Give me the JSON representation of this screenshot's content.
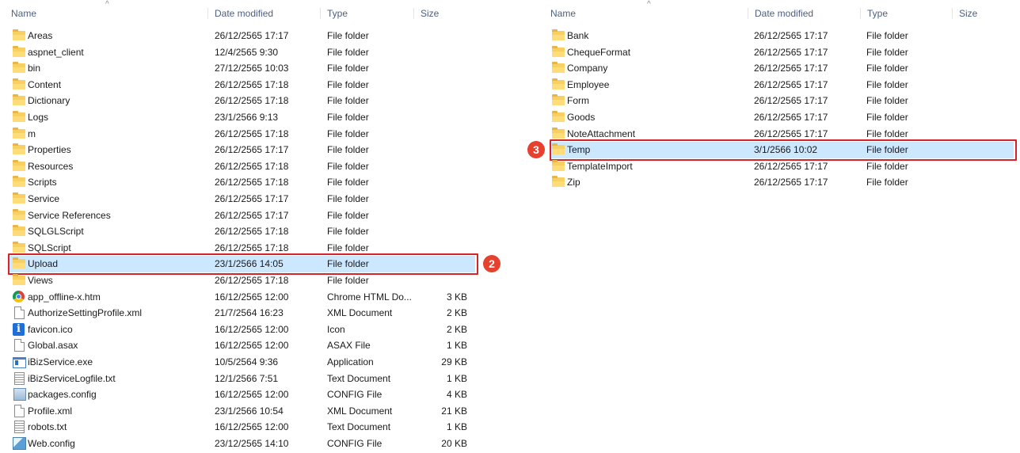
{
  "columns": {
    "name": "Name",
    "date": "Date modified",
    "type": "Type",
    "size": "Size"
  },
  "left_pane": {
    "rows": [
      {
        "name": "Areas",
        "date": "26/12/2565 17:17",
        "type": "File folder",
        "size": "",
        "icon": "folder-icon"
      },
      {
        "name": "aspnet_client",
        "date": "12/4/2565 9:30",
        "type": "File folder",
        "size": "",
        "icon": "folder-icon"
      },
      {
        "name": "bin",
        "date": "27/12/2565 10:03",
        "type": "File folder",
        "size": "",
        "icon": "folder-icon"
      },
      {
        "name": "Content",
        "date": "26/12/2565 17:18",
        "type": "File folder",
        "size": "",
        "icon": "folder-icon"
      },
      {
        "name": "Dictionary",
        "date": "26/12/2565 17:18",
        "type": "File folder",
        "size": "",
        "icon": "folder-icon"
      },
      {
        "name": "Logs",
        "date": "23/1/2566 9:13",
        "type": "File folder",
        "size": "",
        "icon": "folder-icon"
      },
      {
        "name": "m",
        "date": "26/12/2565 17:18",
        "type": "File folder",
        "size": "",
        "icon": "folder-icon"
      },
      {
        "name": "Properties",
        "date": "26/12/2565 17:17",
        "type": "File folder",
        "size": "",
        "icon": "folder-icon"
      },
      {
        "name": "Resources",
        "date": "26/12/2565 17:18",
        "type": "File folder",
        "size": "",
        "icon": "folder-icon"
      },
      {
        "name": "Scripts",
        "date": "26/12/2565 17:18",
        "type": "File folder",
        "size": "",
        "icon": "folder-icon"
      },
      {
        "name": "Service",
        "date": "26/12/2565 17:17",
        "type": "File folder",
        "size": "",
        "icon": "folder-icon"
      },
      {
        "name": "Service References",
        "date": "26/12/2565 17:17",
        "type": "File folder",
        "size": "",
        "icon": "folder-icon"
      },
      {
        "name": "SQLGLScript",
        "date": "26/12/2565 17:18",
        "type": "File folder",
        "size": "",
        "icon": "folder-icon"
      },
      {
        "name": "SQLScript",
        "date": "26/12/2565 17:18",
        "type": "File folder",
        "size": "",
        "icon": "folder-icon"
      },
      {
        "name": "Upload",
        "date": "23/1/2566 14:05",
        "type": "File folder",
        "size": "",
        "icon": "folder-icon",
        "selected": true,
        "callout": "2"
      },
      {
        "name": "Views",
        "date": "26/12/2565 17:18",
        "type": "File folder",
        "size": "",
        "icon": "folder-icon"
      },
      {
        "name": "app_offline-x.htm",
        "date": "16/12/2565 12:00",
        "type": "Chrome HTML Do...",
        "size": "3 KB",
        "icon": "chrome-icon"
      },
      {
        "name": "AuthorizeSettingProfile.xml",
        "date": "21/7/2564 16:23",
        "type": "XML Document",
        "size": "2 KB",
        "icon": "document-icon"
      },
      {
        "name": "favicon.ico",
        "date": "16/12/2565 12:00",
        "type": "Icon",
        "size": "2 KB",
        "icon": "info-icon"
      },
      {
        "name": "Global.asax",
        "date": "16/12/2565 12:00",
        "type": "ASAX File",
        "size": "1 KB",
        "icon": "document-icon"
      },
      {
        "name": "iBizService.exe",
        "date": "10/5/2564 9:36",
        "type": "Application",
        "size": "29 KB",
        "icon": "application-icon"
      },
      {
        "name": "iBizServiceLogfile.txt",
        "date": "12/1/2566 7:51",
        "type": "Text Document",
        "size": "1 KB",
        "icon": "text-file-icon"
      },
      {
        "name": "packages.config",
        "date": "16/12/2565 12:00",
        "type": "CONFIG File",
        "size": "4 KB",
        "icon": "config-icon"
      },
      {
        "name": "Profile.xml",
        "date": "23/1/2566 10:54",
        "type": "XML Document",
        "size": "21 KB",
        "icon": "document-icon"
      },
      {
        "name": "robots.txt",
        "date": "16/12/2565 12:00",
        "type": "Text Document",
        "size": "1 KB",
        "icon": "text-file-icon"
      },
      {
        "name": "Web.config",
        "date": "23/12/2565 14:10",
        "type": "CONFIG File",
        "size": "20 KB",
        "icon": "web-config-icon"
      }
    ]
  },
  "right_pane": {
    "rows": [
      {
        "name": "Bank",
        "date": "26/12/2565 17:17",
        "type": "File folder",
        "size": "",
        "icon": "folder-icon"
      },
      {
        "name": "ChequeFormat",
        "date": "26/12/2565 17:17",
        "type": "File folder",
        "size": "",
        "icon": "folder-icon"
      },
      {
        "name": "Company",
        "date": "26/12/2565 17:17",
        "type": "File folder",
        "size": "",
        "icon": "folder-icon"
      },
      {
        "name": "Employee",
        "date": "26/12/2565 17:17",
        "type": "File folder",
        "size": "",
        "icon": "folder-icon"
      },
      {
        "name": "Form",
        "date": "26/12/2565 17:17",
        "type": "File folder",
        "size": "",
        "icon": "folder-icon"
      },
      {
        "name": "Goods",
        "date": "26/12/2565 17:17",
        "type": "File folder",
        "size": "",
        "icon": "folder-icon"
      },
      {
        "name": "NoteAttachment",
        "date": "26/12/2565 17:17",
        "type": "File folder",
        "size": "",
        "icon": "folder-icon"
      },
      {
        "name": "Temp",
        "date": "3/1/2566 10:02",
        "type": "File folder",
        "size": "",
        "icon": "folder-icon",
        "selected": true,
        "callout": "3"
      },
      {
        "name": "TemplateImport",
        "date": "26/12/2565 17:17",
        "type": "File folder",
        "size": "",
        "icon": "folder-icon"
      },
      {
        "name": "Zip",
        "date": "26/12/2565 17:17",
        "type": "File folder",
        "size": "",
        "icon": "folder-icon"
      }
    ]
  },
  "colors": {
    "selection": "#cce8ff",
    "callout": "#e5412e",
    "highlight_border": "#d4232b",
    "header_text": "#4d6082"
  }
}
